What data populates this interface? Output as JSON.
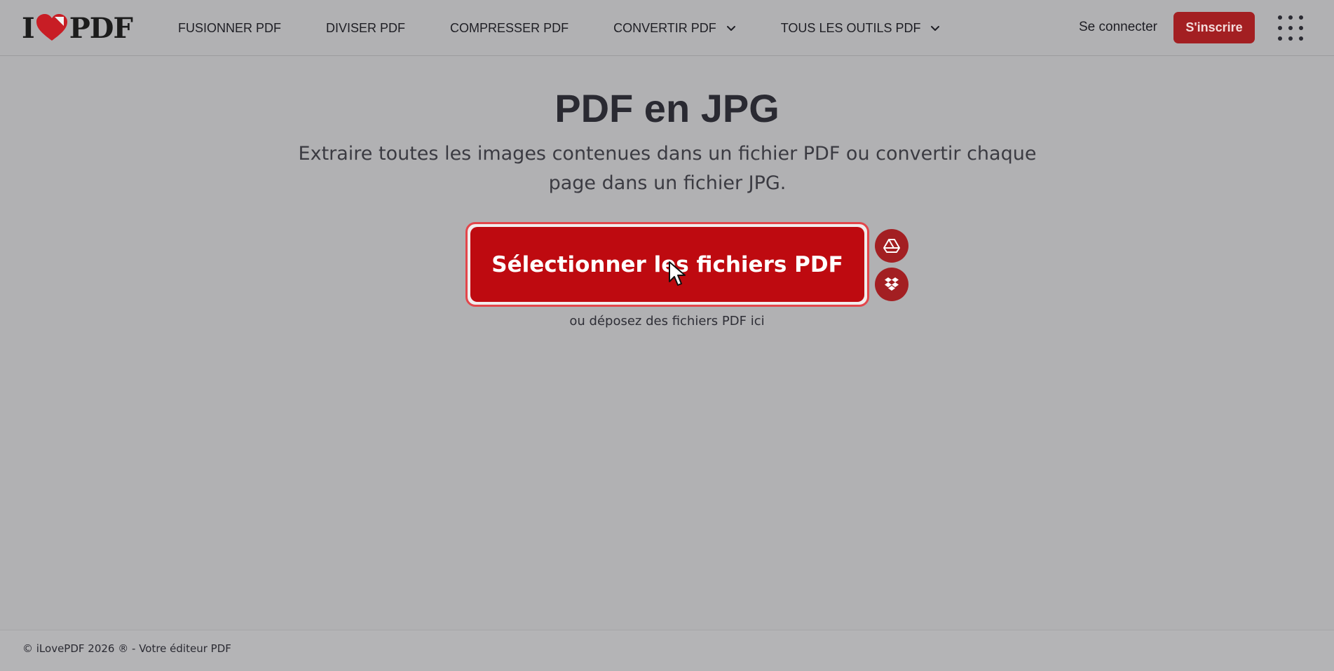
{
  "header": {
    "logo": {
      "left": "I",
      "right": "PDF",
      "heart_color": "#c81d25"
    },
    "nav": [
      {
        "label": "FUSIONNER PDF",
        "dropdown": false
      },
      {
        "label": "DIVISER PDF",
        "dropdown": false
      },
      {
        "label": "COMPRESSER PDF",
        "dropdown": false
      },
      {
        "label": "CONVERTIR PDF",
        "dropdown": true
      },
      {
        "label": "TOUS LES OUTILS PDF",
        "dropdown": true
      }
    ],
    "login_label": "Se connecter",
    "signup_label": "S'inscrire",
    "apps_icon": "grid-icon"
  },
  "main": {
    "title": "PDF en JPG",
    "subtitle": "Extraire toutes les images contenues dans un fichier PDF ou convertir chaque page dans un fichier JPG.",
    "upload_label": "Sélectionner les fichiers PDF",
    "cloud_buttons": [
      {
        "service": "google-drive",
        "icon": "google-drive-icon"
      },
      {
        "service": "dropbox",
        "icon": "dropbox-icon"
      }
    ],
    "drop_hint": "ou déposez des fichiers PDF ici"
  },
  "footer": {
    "text": "© iLovePDF 2026 ® - Votre éditeur PDF"
  },
  "colors": {
    "overlay_bg": "#b1b1b3",
    "brand_red": "#be0a10",
    "signup_red": "#a31f22",
    "text_dark": "#2a2a32"
  }
}
